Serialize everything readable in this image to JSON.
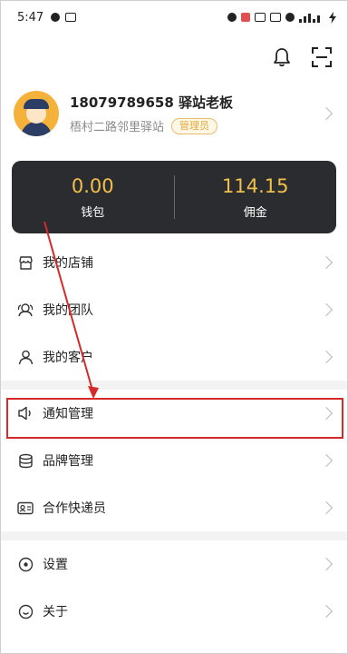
{
  "status_bar": {
    "time": "5:47"
  },
  "profile": {
    "name": "18079789658 驿站老板",
    "station": "梧村二路邻里驿站",
    "role_badge": "管理员"
  },
  "wallet": {
    "balance": "0.00",
    "balance_label": "钱包",
    "commission": "114.15",
    "commission_label": "佣金"
  },
  "menu": {
    "store": "我的店铺",
    "team": "我的团队",
    "customers": "我的客户",
    "notify": "通知管理",
    "brand": "品牌管理",
    "couriers": "合作快递员",
    "settings": "设置",
    "about": "关于"
  },
  "colors": {
    "accent": "#f2c04a",
    "highlight": "#d62a2a"
  }
}
